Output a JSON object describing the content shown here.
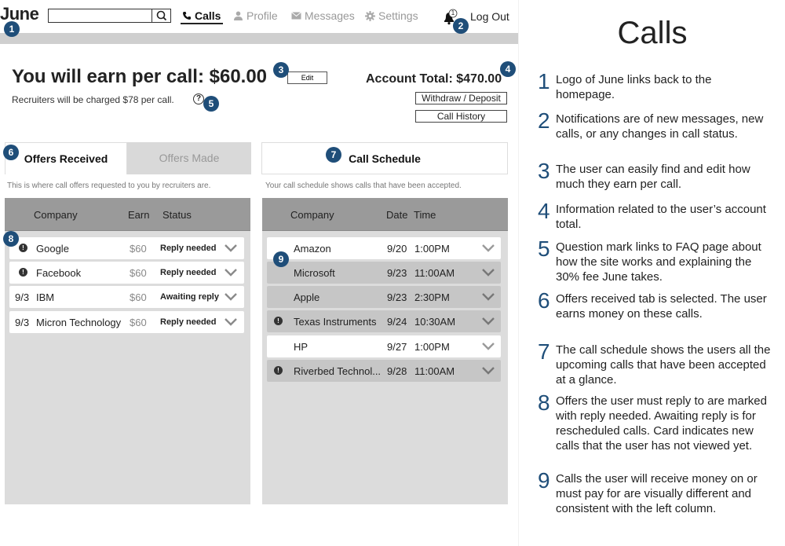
{
  "header": {
    "logo": "June",
    "search": {
      "value": "",
      "placeholder": ""
    },
    "nav": [
      {
        "label": "Calls",
        "icon": "phone-icon",
        "active": true
      },
      {
        "label": "Profile",
        "icon": "person-icon",
        "active": false
      },
      {
        "label": "Messages",
        "icon": "envelope-icon",
        "active": false
      },
      {
        "label": "Settings",
        "icon": "gear-icon",
        "active": false
      }
    ],
    "notifications_count": "1",
    "logout": "Log Out"
  },
  "earnings": {
    "title": "You will earn per call: $60.00",
    "edit_label": "Edit",
    "charged_note": "Recruiters will be charged $78 per call.",
    "help": "?",
    "account_total": "Account Total: $470.00",
    "withdraw_label": "Withdraw / Deposit",
    "history_label": "Call History"
  },
  "offers": {
    "tab_received": "Offers Received",
    "tab_made": "Offers Made",
    "note": "This is where call offers requested to you by recruiters are.",
    "columns": {
      "company": "Company",
      "earn": "Earn",
      "status": "Status"
    },
    "rows": [
      {
        "prefix": "!",
        "prefix_is_icon": true,
        "company": "Google",
        "earn": "$60",
        "status": "Reply needed"
      },
      {
        "prefix": "!",
        "prefix_is_icon": true,
        "company": "Facebook",
        "earn": "$60",
        "status": "Reply needed"
      },
      {
        "prefix": "9/3",
        "prefix_is_icon": false,
        "company": "IBM",
        "earn": "$60",
        "status": "Awaiting reply"
      },
      {
        "prefix": "9/3",
        "prefix_is_icon": false,
        "company": "Micron Technology",
        "earn": "$60",
        "status": "Reply needed"
      }
    ]
  },
  "schedule": {
    "tab": "Call Schedule",
    "note": "Your call schedule shows calls that have been accepted.",
    "columns": {
      "company": "Company",
      "date": "Date",
      "time": "Time"
    },
    "rows": [
      {
        "alert": false,
        "style": "white",
        "company": "Amazon",
        "date": "9/20",
        "time": "1:00PM"
      },
      {
        "alert": false,
        "style": "grey",
        "company": "Microsoft",
        "date": "9/23",
        "time": "11:00AM"
      },
      {
        "alert": false,
        "style": "grey",
        "company": "Apple",
        "date": "9/23",
        "time": "2:30PM"
      },
      {
        "alert": true,
        "style": "grey",
        "company": "Texas Instruments",
        "date": "9/24",
        "time": "10:30AM"
      },
      {
        "alert": false,
        "style": "white",
        "company": "HP",
        "date": "9/27",
        "time": "1:00PM"
      },
      {
        "alert": true,
        "style": "grey",
        "company": "Riverbed Technol...",
        "date": "9/28",
        "time": "11:00AM"
      }
    ]
  },
  "markers": [
    "1",
    "2",
    "3",
    "4",
    "5",
    "6",
    "7",
    "8",
    "9"
  ],
  "annotations": {
    "title": "Calls",
    "items": [
      {
        "num": "1",
        "text": "Logo of June links back to the homepage."
      },
      {
        "num": "2",
        "text": "Notifications are of new messages, new calls, or any changes in call status."
      },
      {
        "num": "3",
        "text": "The user can easily find and edit how much they earn per call."
      },
      {
        "num": "4",
        "text": "Information related to the user’s account total."
      },
      {
        "num": "5",
        "text": "Question mark links to FAQ page about how the site works and explaining the 30% fee June takes."
      },
      {
        "num": "6",
        "text": "Offers received tab is selected. The user earns money on these calls."
      },
      {
        "num": "7",
        "text": "The call schedule shows the users all the upcoming calls that have been accepted at a glance."
      },
      {
        "num": "8",
        "text": "Offers the user must reply to are marked with reply needed. Awaiting reply is for rescheduled calls. Card indicates new calls that the user has not viewed yet."
      },
      {
        "num": "9",
        "text": "Calls the user will receive money on or must pay for are visually different and consistent with the left column."
      }
    ]
  },
  "colors": {
    "accent": "#1f4e79",
    "panel": "#dcdcdc",
    "panel_header": "#9a9a9a"
  }
}
